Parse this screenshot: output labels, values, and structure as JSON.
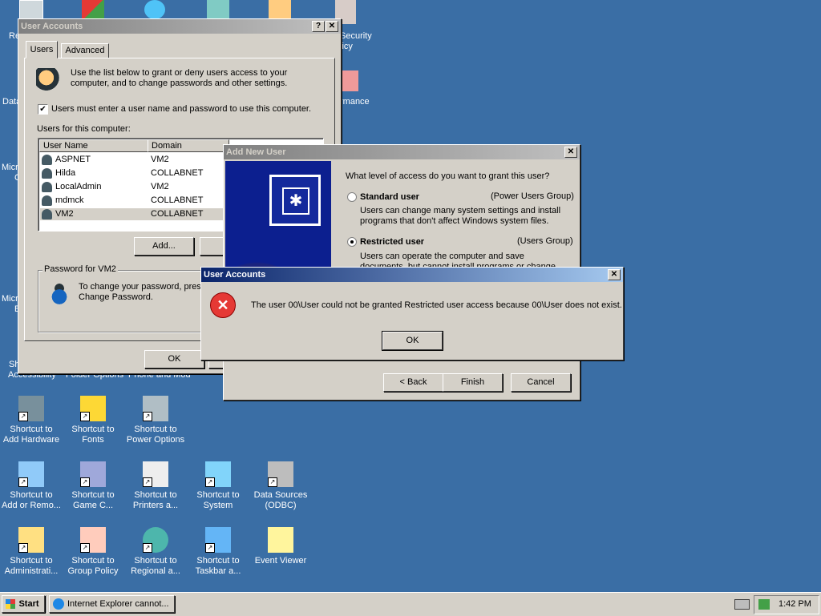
{
  "desktop": {
    "partial_labels": [
      "Re",
      "Security",
      "licy",
      "Data",
      "rmance",
      "Micro",
      "C",
      "Micro",
      "B",
      "Sh",
      "Accessibility",
      "Folder Options",
      "Phone and Mod"
    ],
    "icons": [
      {
        "line1": "Shortcut to",
        "line2": "Add Hardware",
        "icon": "add-hardware-icon"
      },
      {
        "line1": "Shortcut to",
        "line2": "Fonts",
        "icon": "fonts-folder-icon"
      },
      {
        "line1": "Shortcut to",
        "line2": "Power Options",
        "icon": "power-options-icon"
      },
      {
        "line1": "Shortcut to",
        "line2": "Add or Remo...",
        "icon": "add-remove-programs-icon"
      },
      {
        "line1": "Shortcut to",
        "line2": "Game C...",
        "icon": "game-controllers-icon"
      },
      {
        "line1": "Shortcut to",
        "line2": "Printers a...",
        "icon": "printers-icon"
      },
      {
        "line1": "Shortcut to",
        "line2": "System",
        "icon": "system-icon"
      },
      {
        "line1": "Data Sources",
        "line2": "(ODBC)",
        "icon": "odbc-icon"
      },
      {
        "line1": "Shortcut to",
        "line2": "Administrati...",
        "icon": "admin-tools-icon"
      },
      {
        "line1": "Shortcut to",
        "line2": "Group Policy",
        "icon": "group-policy-icon"
      },
      {
        "line1": "Shortcut to",
        "line2": "Regional a...",
        "icon": "regional-icon"
      },
      {
        "line1": "Shortcut to",
        "line2": "Taskbar a...",
        "icon": "taskbar-icon"
      },
      {
        "line1": "Event Viewer",
        "line2": "",
        "icon": "event-viewer-icon"
      }
    ]
  },
  "user_accounts": {
    "title": "User Accounts",
    "tabs": [
      "Users",
      "Advanced"
    ],
    "intro": "Use the list below to grant or deny users access to your computer, and to change passwords and other settings.",
    "checkbox_label": "Users must enter a user name and password to use this computer.",
    "list_label": "Users for this computer:",
    "columns": [
      "User Name",
      "Domain",
      "G"
    ],
    "rows": [
      {
        "name": "ASPNET",
        "domain": "VM2"
      },
      {
        "name": "Hilda",
        "domain": "COLLABNET"
      },
      {
        "name": "LocalAdmin",
        "domain": "VM2"
      },
      {
        "name": "mdmck",
        "domain": "COLLABNET"
      },
      {
        "name": "VM2",
        "domain": "COLLABNET"
      }
    ],
    "add_btn": "Add...",
    "remove_btn": "Re",
    "password_group": "Password for VM2",
    "password_text": "To change your password, pres Change Password.",
    "ok_btn": "OK"
  },
  "add_new_user": {
    "title": "Add New User",
    "question": "What level of access do you want to grant this user?",
    "standard_label": "Standard user",
    "standard_group": "(Power Users Group)",
    "standard_desc": "Users can change many system settings and install programs that don't affect Windows system files.",
    "restricted_label": "Restricted user",
    "restricted_group": "(Users Group)",
    "restricted_desc": "Users can operate the computer and save documents, but cannot install programs or change system settings.",
    "back_btn": "< Back",
    "finish_btn": "Finish",
    "cancel_btn": "Cancel"
  },
  "error_dialog": {
    "title": "User Accounts",
    "message": "The user 00\\User could not be granted Restricted user access because 00\\User does not exist.",
    "ok_btn": "OK"
  },
  "taskbar": {
    "start": "Start",
    "task": "Internet Explorer cannot...",
    "clock": "1:42 PM"
  },
  "colors": {
    "desktop": "#3a6ea5",
    "active_title": "#0a246a",
    "inactive_title": "#808080",
    "wizard_banner": "#0c1f8f"
  }
}
